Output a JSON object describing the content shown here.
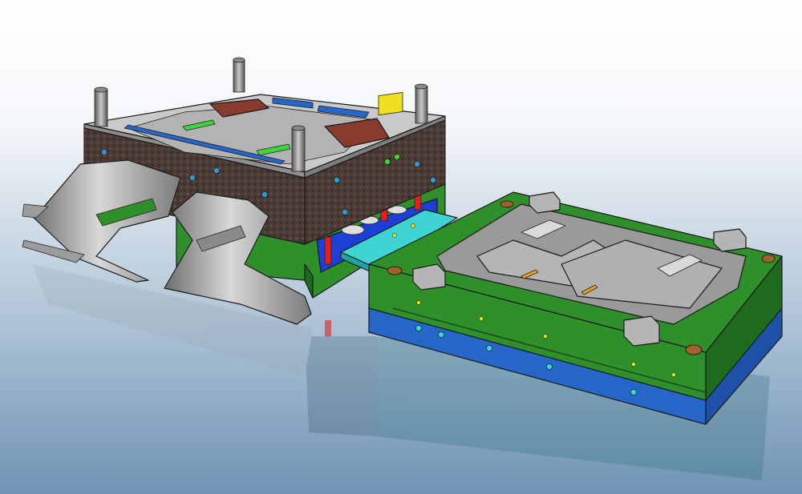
{
  "scene": {
    "colors": {
      "background_top": "#ffffff",
      "background_bottom": "#6f94b4",
      "mold_green": "#2f8f2a",
      "mold_green_dark": "#1f6b1d",
      "clamp_blue": "#2566c8",
      "cavity_grey": "#9a9a9a",
      "textured_brown": "#4a3a34",
      "insert_red": "#8a3b30",
      "plate_cyan": "#3fd3d3",
      "ejector_red": "#e02020",
      "bushing_bronze": "#a0622c",
      "part_steel": "#b8b8b8"
    }
  }
}
